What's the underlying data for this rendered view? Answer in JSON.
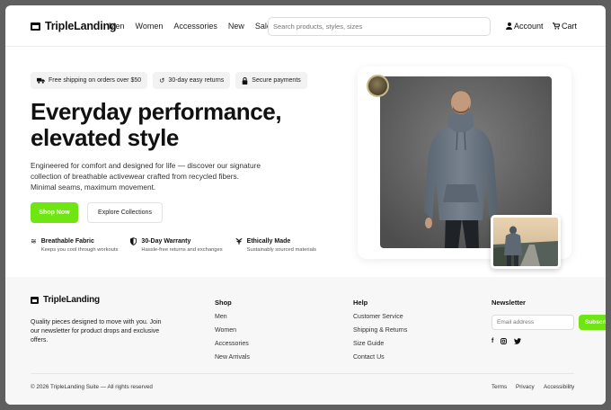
{
  "brand": {
    "name": "TripleLanding"
  },
  "nav": [
    "Men",
    "Women",
    "Accessories",
    "New",
    "Sale"
  ],
  "search": {
    "placeholder": "Search products, styles, sizes"
  },
  "header_actions": {
    "account": "Account",
    "cart": "Cart"
  },
  "badges": [
    {
      "icon": "truck-icon",
      "label": "Free shipping on orders over $50"
    },
    {
      "icon": "return-icon",
      "label": "30-day easy returns"
    },
    {
      "icon": "lock-icon",
      "label": "Secure payments"
    }
  ],
  "hero": {
    "headline_line1": "Everyday performance,",
    "headline_line2": "elevated style",
    "description": "Engineered for comfort and designed for life — discover our signature collection of breathable activewear crafted from recycled fibers. Minimal seams, maximum movement.",
    "primary_cta": "Shop Now",
    "secondary_cta": "Explore Collections"
  },
  "features": [
    {
      "icon": "wind-icon",
      "title": "Breathable Fabric",
      "subtitle": "Keeps you cool through workouts"
    },
    {
      "icon": "shield-icon",
      "title": "30-Day Warranty",
      "subtitle": "Hassle-free returns and exchanges"
    },
    {
      "icon": "leaf-icon",
      "title": "Ethically Made",
      "subtitle": "Sustainably sourced materials"
    }
  ],
  "footer": {
    "brand": "TripleLanding",
    "about": "Quality pieces designed to move with you. Join our newsletter for product drops and exclusive offers.",
    "shop": {
      "title": "Shop",
      "items": [
        "Men",
        "Women",
        "Accessories",
        "New Arrivals"
      ]
    },
    "help": {
      "title": "Help",
      "items": [
        "Customer Service",
        "Shipping & Returns",
        "Size Guide",
        "Contact Us"
      ]
    },
    "newsletter": {
      "title": "Newsletter",
      "email_placeholder": "Email address",
      "button": "Subscribe"
    },
    "social": [
      "facebook-icon",
      "instagram-icon",
      "twitter-icon"
    ],
    "copyright": "© 2026 TripleLanding Suite — All rights reserved",
    "legal": [
      "Terms",
      "Privacy",
      "Accessibility"
    ]
  },
  "colors": {
    "accent": "#6fe514",
    "text": "#111111",
    "footer_bg": "#f7f7f7",
    "badge_bg": "#f2f2f2"
  }
}
